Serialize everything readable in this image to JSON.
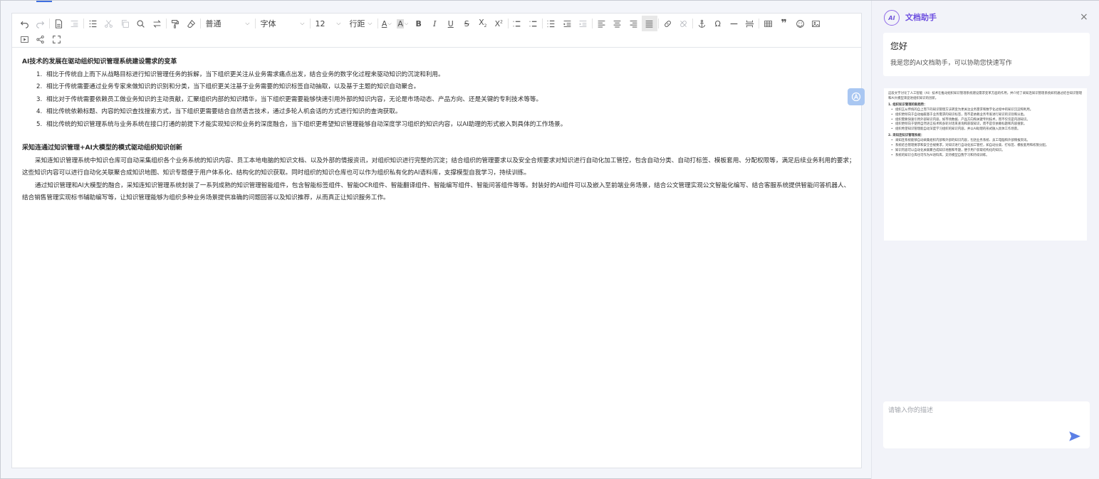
{
  "toolbar": {
    "paragraph_style": "普通",
    "font_family": "字体",
    "font_size": "12",
    "line_height": "行距"
  },
  "document": {
    "section1_title": "AI技术的发展在驱动组织知识管理系统建设需求的变革",
    "section1_items": [
      "相比于传统自上而下从战略目标进行知识管理任务的拆解，当下组织更关注从业务需求痛点出发，结合业务的数字化过程来驱动知识的沉淀和利用。",
      "相比于传统需要通过业务专家来做知识的识别和分类，当下组织更关注基于业务需要的知识标签自动抽取，以及基于主题的知识自动聚合。",
      "相比对于传统需要依赖员工做业务知识的主动贡献，汇聚组织内部的知识精华，当下组织更需要能够快速引用外部的知识内容，无论是市场动态、产品方向、还是关键的专利技术等等。",
      "相比传统依赖标题、内容的知识查找搜索方式，当下组织更需要结合自然语言技术，通过多轮人机会话的方式进行知识的查询获取。",
      "相比传统的知识管理系统与业务系统在接口打通的前提下才能实现知识和业务的深度融合，当下组织更希望知识管理能够自动深度学习组织的知识内容，以AI助理的形式嵌入到具体的工作场景。"
    ],
    "section2_title": "采知连通过知识管理+AI大模型的模式驱动组织知识创新",
    "section2_paragraphs": [
      "采知连知识管理系统中知识仓库可自动采集组织各个业务系统的知识内容、员工本地电脑的知识文档、以及外部的情报资讯，对组织知识进行完整的沉淀；结合组织的管理要求以及安全合规要求对知识进行自动化加工管控，包含自动分类、自动打标签、模板套用、分配权限等，满足后续业务利用的要求；这些知识内容可以进行自动化关联聚合成知识地图、知识专题便于用户体系化、结构化的知识获取。同时组织的知识仓库也可以作为组织私有化的AI语料库，支撑模型自我学习，持续训练。",
      "通过知识管理和AI大模型的融合，采知连知识管理系统封装了一系列成熟的知识管理智能组件，包含智能标签组件、智能OCR组件、智能翻译组件、智能编写组件、智能问答组件等等。封装好的AI组件可以及嵌入至前端业务场景，结合公文管理实现公文智能化编写、结合客服系统提供智能问答机器人、结合销售管理实现标书辅助编写等，让知识管理能够为组织多种业务场景提供准确的问题回答以及知识推荐，从而真正让知识服务工作。"
    ]
  },
  "assistant": {
    "logo_text": "AI",
    "title": "文档助手",
    "close_symbol": "×",
    "greeting": "您好",
    "greeting_sub": "我是您的AI文档助手，可以协助您快速写作",
    "summary_intro": "这段文字讨论了人工智能（AI）技术在推动组织知识管理系统建设需求变革方面的作用，并介绍了采知连知识管理系统如何通过结合知识管理和AI大模型来促进组织知识的创新。",
    "summary_h1": "1. 组织知识管理的新趋势：",
    "summary_list1": [
      "组织正从传统的自上而下的知识管理方法转变为更关注业务需求和数字化过程中的知识沉淀和利用。",
      "组织更倾向于自动抽取基于业务需求的知识标签，而不是依赖业务专家进行知识的识别和分类。",
      "组织需要快速引用外部知识内容，如市场数据、产品方向和关键专利技术，而不仅仅是内部知识。",
      "组织更倾向于使用自然语言技术和多轮对话来查询和获取知识，而不是仅依赖标题和内容搜索。",
      "组织希望知识管理能自动深度学习组织的知识内容，并以AI助理的形式融入具体工作场景。"
    ],
    "summary_h2": "2. 采知连知识管理系统：",
    "summary_list2": [
      "采知连系统能够自动采集组织内部和外部的知识内容，包括业务系统、员工电脑和外部情报资讯。",
      "系统结合管理要求和安全合规要求，对知识进行自动化加工管控，如自动分类、打标签、模板套用和权限分配。",
      "知识内容可以自动化关联聚合成知识地图和专题，便于用户获取结构化的知识。",
      "系统的知识仓库也可作为AI语料库，支持模型自我学习和持续训练。"
    ],
    "input_placeholder": "请输入你的描述"
  }
}
